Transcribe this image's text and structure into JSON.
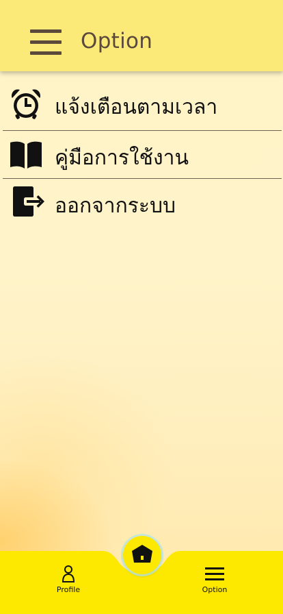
{
  "header": {
    "title": "Option"
  },
  "menu": {
    "items": [
      {
        "label": "แจ้งเตือนตามเวลา",
        "icon": "alarm-clock-icon"
      },
      {
        "label": "คู่มือการใช้งาน",
        "icon": "book-icon"
      },
      {
        "label": "ออกจากระบบ",
        "icon": "logout-icon"
      }
    ]
  },
  "bottom_nav": {
    "profile_label": "Profile",
    "option_label": "Option",
    "home_icon": "home-icon"
  },
  "colors": {
    "header_bg": "#fbe978",
    "bottom_bar_bg": "#fde800",
    "text_dark": "#5b4a3c",
    "background": "#fff3c9"
  }
}
